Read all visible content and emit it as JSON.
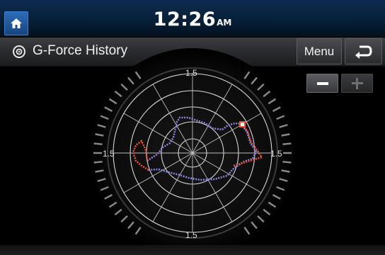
{
  "status_bar": {
    "time": "12:26",
    "ampm": "AM"
  },
  "header": {
    "title": "G-Force History",
    "menu_label": "Menu"
  },
  "icons": {
    "home": "home-icon",
    "title": "gforce-icon",
    "back": "back-arrow-icon",
    "zoom_out": "minus-icon",
    "zoom_in": "plus-icon"
  },
  "zoom": {
    "out_enabled": true,
    "in_enabled": false
  },
  "gauge": {
    "scale_top": "1.5",
    "scale_left": "1.5",
    "scale_right": "1.5",
    "scale_bottom": "1.5"
  },
  "colors": {
    "trace_normal": "#8a86e0",
    "trace_high": "#e8543a",
    "current_marker": "#ffffff",
    "accent_blue": "#2c6bb8"
  }
}
